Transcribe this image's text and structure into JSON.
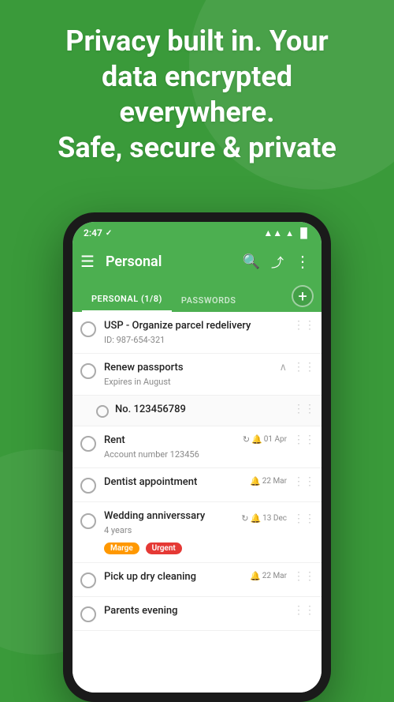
{
  "hero": {
    "title": "Privacy built in. Your data encrypted everywhere.\nSafe, secure & private"
  },
  "status_bar": {
    "time": "2:47",
    "check_icon": "✓",
    "signal": "▲▲",
    "wifi": "▲",
    "battery": "▐"
  },
  "toolbar": {
    "menu_icon": "☰",
    "title": "Personal",
    "search_icon": "🔍",
    "share_icon": "⤴",
    "more_icon": "⋮"
  },
  "tabs": [
    {
      "label": "PERSONAL (1/8)",
      "active": true
    },
    {
      "label": "PASSWORDS",
      "active": false
    }
  ],
  "add_button": "+",
  "list_items": [
    {
      "id": "item-1",
      "title": "USP - Organize parcel redelivery",
      "sub": "ID: 987-654-321",
      "has_checkbox": true,
      "date": null,
      "repeat": false,
      "alarm": false,
      "tags": []
    },
    {
      "id": "item-2",
      "title": "Renew passports",
      "sub": "Expires in August",
      "has_checkbox": true,
      "date": null,
      "repeat": false,
      "alarm": false,
      "tags": [],
      "expanded": true
    },
    {
      "id": "item-2-sub",
      "title": "No. 123456789",
      "sub": null,
      "has_checkbox": false,
      "is_sub": true,
      "date": null,
      "repeat": false,
      "alarm": false,
      "tags": []
    },
    {
      "id": "item-3",
      "title": "Rent",
      "sub": "Account number 123456",
      "has_checkbox": true,
      "date": "01 Apr",
      "repeat": true,
      "alarm": true,
      "tags": []
    },
    {
      "id": "item-4",
      "title": "Dentist appointment",
      "sub": null,
      "has_checkbox": true,
      "date": "22 Mar",
      "repeat": false,
      "alarm": true,
      "tags": []
    },
    {
      "id": "item-5",
      "title": "Wedding anniverssary",
      "sub": "4 years",
      "has_checkbox": true,
      "date": "13 Dec",
      "repeat": true,
      "alarm": true,
      "tags": [
        "Marge",
        "Urgent"
      ]
    },
    {
      "id": "item-6",
      "title": "Pick up dry cleaning",
      "sub": null,
      "has_checkbox": true,
      "date": "22 Mar",
      "repeat": false,
      "alarm": true,
      "tags": []
    },
    {
      "id": "item-7",
      "title": "Parents evening",
      "sub": null,
      "has_checkbox": true,
      "date": null,
      "repeat": false,
      "alarm": false,
      "tags": []
    }
  ],
  "colors": {
    "green_primary": "#4caf50",
    "green_dark": "#388e3c",
    "tag_marge": "#ff9800",
    "tag_urgent": "#e53935"
  }
}
